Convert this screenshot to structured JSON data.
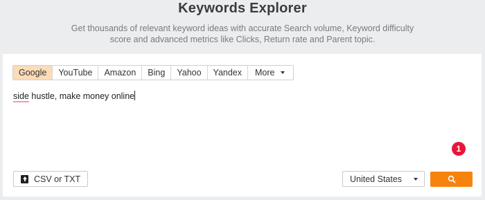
{
  "header": {
    "title": "Keywords Explorer",
    "subtitle_line1": "Get thousands of relevant keyword ideas with accurate Search volume, Keyword difficulty",
    "subtitle_line2": "score and advanced metrics like Clicks, Return rate and Parent topic."
  },
  "search_engines": {
    "tabs": [
      {
        "label": "Google",
        "active": true
      },
      {
        "label": "YouTube",
        "active": false
      },
      {
        "label": "Amazon",
        "active": false
      },
      {
        "label": "Bing",
        "active": false
      },
      {
        "label": "Yahoo",
        "active": false
      },
      {
        "label": "Yandex",
        "active": false
      }
    ],
    "more_label": "More"
  },
  "query": {
    "misspelled_word": "side",
    "rest": " hustle, make money online"
  },
  "notification_badge": "1",
  "upload": {
    "label": "CSV or TXT",
    "icon": "upload-icon"
  },
  "country": {
    "selected": "United States"
  },
  "search_button": {
    "icon": "search-icon"
  },
  "colors": {
    "accent": "#f7830f",
    "active_tab": "#fbdcb8",
    "badge": "#e8163a",
    "background": "#ecedef"
  }
}
